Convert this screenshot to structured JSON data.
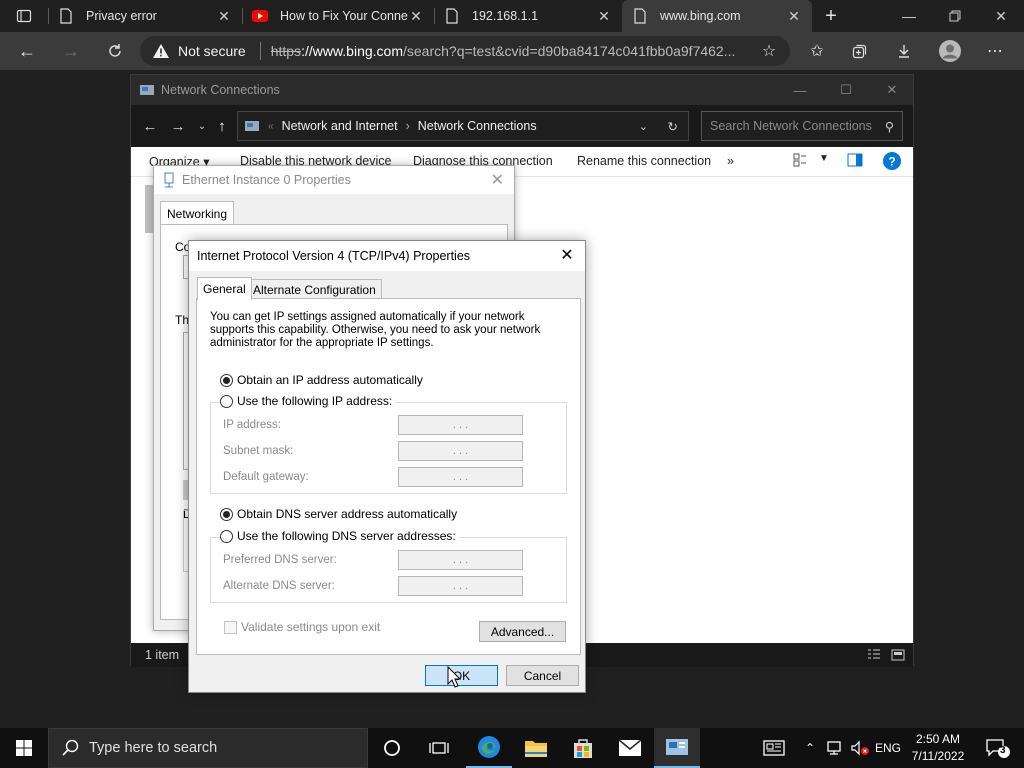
{
  "browser": {
    "tabs": [
      {
        "title": "Privacy error",
        "favicon": "page-icon"
      },
      {
        "title": "How to Fix Your Connec",
        "favicon": "youtube-icon"
      },
      {
        "title": "192.168.1.1",
        "favicon": "page-icon"
      },
      {
        "title": "www.bing.com",
        "favicon": "page-icon",
        "active": true
      }
    ],
    "address": {
      "security_label": "Not secure",
      "scheme": "https",
      "host": "://www.bing.com",
      "rest": "/search?q=test&cvid=d90ba84174c041fbb0a9f7462..."
    }
  },
  "explorer": {
    "title": "Network Connections",
    "path": [
      "Network and Internet",
      "Network Connections"
    ],
    "search_placeholder": "Search Network Connections",
    "commands": [
      "Organize ▾",
      "Disable this network device",
      "Diagnose this connection",
      "Rename this connection",
      "»"
    ],
    "status": "1 item"
  },
  "ethernet_dialog": {
    "title": "Ethernet Instance 0 Properties",
    "tab": "Networking",
    "fragments": [
      "Connect using:",
      "Th",
      "D"
    ]
  },
  "ipv4_dialog": {
    "title": "Internet Protocol Version 4 (TCP/IPv4) Properties",
    "tabs": [
      "General",
      "Alternate Configuration"
    ],
    "description": "You can get IP settings assigned automatically if your network supports this capability. Otherwise, you need to ask your network administrator for the appropriate IP settings.",
    "ip_auto": "Obtain an IP address automatically",
    "ip_manual": "Use the following IP address:",
    "ip_fields": [
      "IP address:",
      "Subnet mask:",
      "Default gateway:"
    ],
    "dns_auto": "Obtain DNS server address automatically",
    "dns_manual": "Use the following DNS server addresses:",
    "dns_fields": [
      "Preferred DNS server:",
      "Alternate DNS server:"
    ],
    "validate": "Validate settings upon exit",
    "advanced": "Advanced...",
    "ok": "OK",
    "cancel": "Cancel",
    "ip_dots": ".   .   ."
  },
  "taskbar": {
    "search_placeholder": "Type here to search",
    "language": "ENG",
    "time": "2:50 AM",
    "date": "7/11/2022",
    "notifications": "3"
  },
  "colors": {
    "accent": "#0078d7",
    "chrome_dark": "#202020",
    "youtube_red": "#ff0000"
  }
}
